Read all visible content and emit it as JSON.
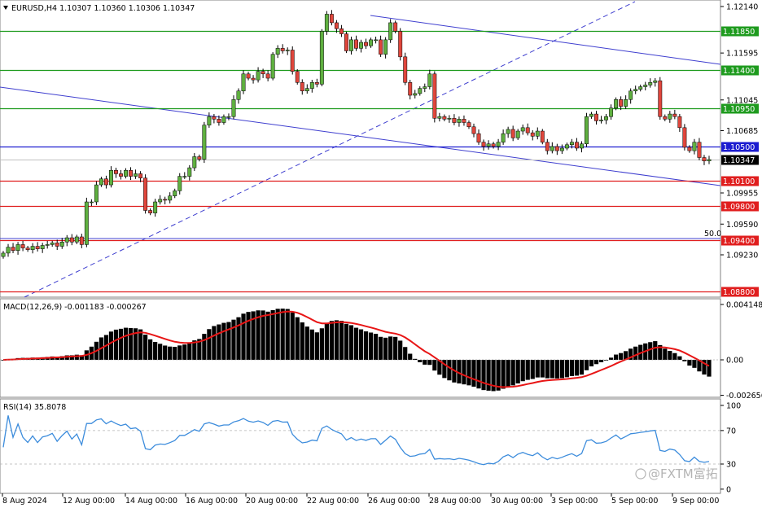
{
  "header": {
    "symbol_line": "EURUSD,H4  1.10307 1.10360 1.10306 1.10347"
  },
  "colors": {
    "bull": "#5fb040",
    "bear": "#e0463c",
    "wick": "#000000",
    "green_level": "#1e9b1e",
    "blue_level": "#1c1cd0",
    "red_level": "#e01e1e",
    "channel": "#3f3fcf",
    "macd_signal": "#e81515",
    "rsi_line": "#3c8cdc",
    "grid_dash": "#b4b4b4"
  },
  "price_axis": {
    "ticks": [
      "1.12140",
      "1.11595",
      "1.11045",
      "1.10685",
      "1.09955",
      "1.09590",
      "1.09230"
    ]
  },
  "levels": [
    {
      "label": "1.11850",
      "value": 1.1185,
      "kind": "green"
    },
    {
      "label": "1.11400",
      "value": 1.114,
      "kind": "green"
    },
    {
      "label": "1.10950",
      "value": 1.1095,
      "kind": "green"
    },
    {
      "label": "1.10500",
      "value": 1.105,
      "kind": "blue"
    },
    {
      "label": "1.10347",
      "value": 1.10347,
      "kind": "current"
    },
    {
      "label": "1.10100",
      "value": 1.101,
      "kind": "red"
    },
    {
      "label": "1.09800",
      "value": 1.098,
      "kind": "red"
    },
    {
      "label": "1.09400",
      "value": 1.094,
      "kind": "red"
    },
    {
      "label": "1.08800",
      "value": 1.088,
      "kind": "red"
    }
  ],
  "fib_label": "50.0",
  "macd": {
    "title": "MACD(12,26,9) -0.001183 -0.000267",
    "ticks": [
      "0.004148",
      "0.00",
      "-0.002656"
    ]
  },
  "rsi": {
    "title": "RSI(14) 35.8078",
    "ticks": [
      "100",
      "70",
      "30",
      "0"
    ]
  },
  "time_axis": {
    "labels": [
      "8 Aug 2024",
      "12 Aug 00:00",
      "14 Aug 00:00",
      "16 Aug 00:00",
      "20 Aug 00:00",
      "22 Aug 00:00",
      "26 Aug 00:00",
      "28 Aug 00:00",
      "30 Aug 00:00",
      "3 Sep 00:00",
      "5 Sep 00:00",
      "9 Sep 00:00"
    ]
  },
  "watermark": "@FXTM富拓",
  "chart_data": {
    "type": "candlestick",
    "symbol": "EURUSD",
    "timeframe": "H4",
    "ohlc_last": {
      "open": 1.10307,
      "high": 1.1036,
      "low": 1.10306,
      "close": 1.10347
    },
    "closes": [
      1.0925,
      1.0932,
      1.0928,
      1.0935,
      1.0931,
      1.0929,
      1.0933,
      1.093,
      1.0934,
      1.0935,
      1.0937,
      1.0933,
      1.0938,
      1.0943,
      1.0938,
      1.0944,
      1.0935,
      1.0985,
      1.0985,
      1.1005,
      1.1012,
      1.1005,
      1.1022,
      1.1018,
      1.1015,
      1.1022,
      1.1015,
      1.1018,
      1.1013,
      1.0975,
      1.0972,
      1.0985,
      1.0988,
      1.0987,
      1.0992,
      1.0998,
      1.1015,
      1.1015,
      1.1025,
      1.1038,
      1.1035,
      1.1075,
      1.1085,
      1.1082,
      1.1078,
      1.1085,
      1.1085,
      1.1105,
      1.1115,
      1.1135,
      1.113,
      1.1128,
      1.1138,
      1.1135,
      1.113,
      1.1158,
      1.1165,
      1.1162,
      1.1163,
      1.1138,
      1.1125,
      1.1115,
      1.1118,
      1.1125,
      1.1123,
      1.1185,
      1.1205,
      1.1195,
      1.1188,
      1.1182,
      1.1162,
      1.1175,
      1.1165,
      1.1172,
      1.1168,
      1.1175,
      1.1175,
      1.1158,
      1.1175,
      1.1195,
      1.1185,
      1.1155,
      1.1125,
      1.111,
      1.1112,
      1.1118,
      1.112,
      1.1135,
      1.1083,
      1.1085,
      1.1082,
      1.1083,
      1.1078,
      1.1082,
      1.1078,
      1.1073,
      1.1065,
      1.1055,
      1.105,
      1.1053,
      1.105,
      1.1055,
      1.1065,
      1.107,
      1.106,
      1.1068,
      1.1072,
      1.1066,
      1.1062,
      1.1068,
      1.1055,
      1.1045,
      1.105,
      1.1045,
      1.1048,
      1.1052,
      1.1055,
      1.1048,
      1.1053,
      1.1085,
      1.1088,
      1.108,
      1.1081,
      1.1085,
      1.1095,
      1.1105,
      1.1097,
      1.1105,
      1.1115,
      1.1117,
      1.112,
      1.1122,
      1.1125,
      1.1127,
      1.1085,
      1.1082,
      1.1088,
      1.1085,
      1.1072,
      1.1049,
      1.1045,
      1.1055,
      1.1037,
      1.1033,
      1.10347
    ],
    "macd_hist_first_last": [
      0.0008,
      -0.0012
    ],
    "rsi_range": [
      20,
      85
    ],
    "ylim": [
      1.0875,
      1.1221
    ]
  }
}
